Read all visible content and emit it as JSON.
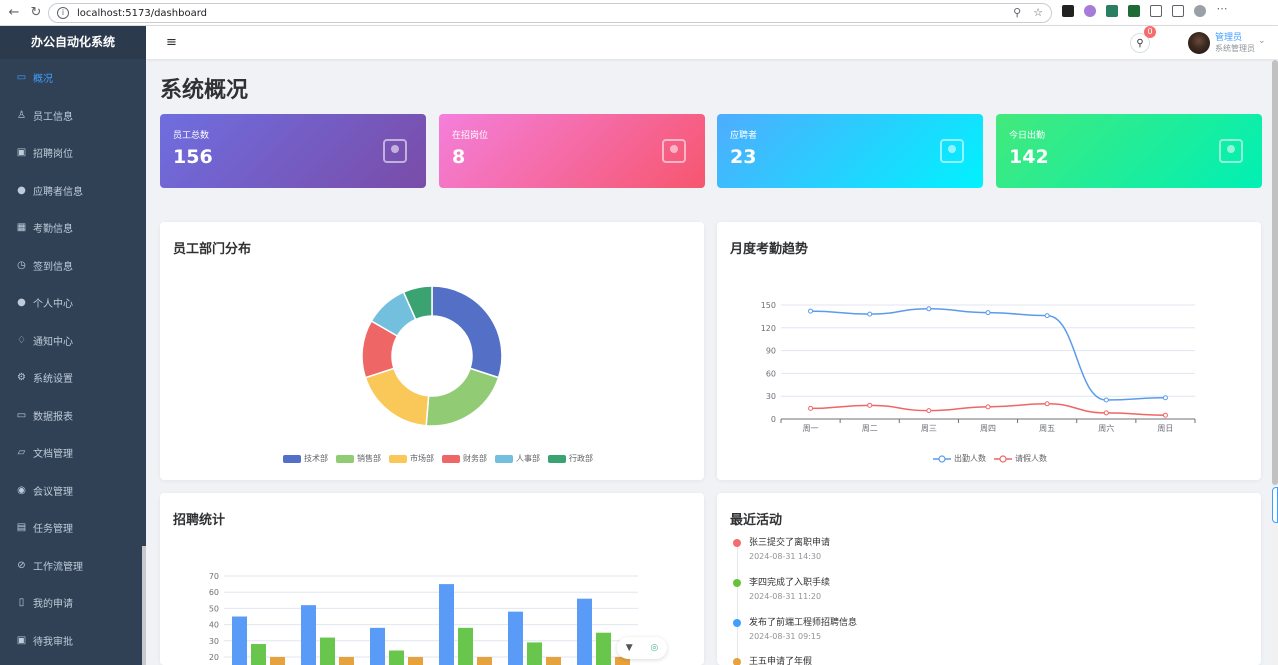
{
  "browser": {
    "url": "localhost:5173/dashboard"
  },
  "sidebar": {
    "logo": "办公自动化系统",
    "items": [
      {
        "label": "概况",
        "icon": "monitor-icon",
        "active": true
      },
      {
        "label": "员工信息",
        "icon": "user-icon"
      },
      {
        "label": "招聘岗位",
        "icon": "briefcase-icon"
      },
      {
        "label": "应聘者信息",
        "icon": "person-icon"
      },
      {
        "label": "考勤信息",
        "icon": "calendar-icon"
      },
      {
        "label": "签到信息",
        "icon": "clock-icon"
      },
      {
        "label": "个人中心",
        "icon": "user-filled-icon"
      },
      {
        "label": "通知中心",
        "icon": "bell-icon"
      },
      {
        "label": "系统设置",
        "icon": "gear-icon"
      },
      {
        "label": "数据报表",
        "icon": "report-icon"
      },
      {
        "label": "文档管理",
        "icon": "folder-icon"
      },
      {
        "label": "会议管理",
        "icon": "video-icon"
      },
      {
        "label": "任务管理",
        "icon": "task-icon"
      },
      {
        "label": "工作流管理",
        "icon": "link-icon"
      },
      {
        "label": "我的申请",
        "icon": "document-icon"
      },
      {
        "label": "待我审批",
        "icon": "approve-icon"
      }
    ]
  },
  "header": {
    "notifications": "0",
    "user_name": "管理员",
    "user_role": "系统管理员"
  },
  "page": {
    "title": "系统概况"
  },
  "stats": [
    {
      "label": "员工总数",
      "value": "156",
      "icon": "user-outline-icon",
      "from": "#6f6ee0",
      "to": "#7a4ca8"
    },
    {
      "label": "在招岗位",
      "value": "8",
      "icon": "briefcase-icon",
      "from": "#f47fdb",
      "to": "#f6566e"
    },
    {
      "label": "应聘者",
      "value": "23",
      "icon": "person-icon",
      "from": "#4facfe",
      "to": "#00f2fe"
    },
    {
      "label": "今日出勤",
      "value": "142",
      "icon": "calendar-icon",
      "from": "#43e97b",
      "to": "#00f0b5"
    }
  ],
  "panels": {
    "dept": "员工部门分布",
    "trend": "月度考勤趋势",
    "recruit": "招聘统计",
    "activity": "最近活动"
  },
  "chart_data": [
    {
      "type": "pie",
      "title": "员工部门分布",
      "categories": [
        "技术部",
        "销售部",
        "市场部",
        "财务部",
        "人事部",
        "行政部"
      ],
      "values": [
        45,
        32,
        28,
        20,
        15,
        10
      ],
      "colors": [
        "#5470c6",
        "#91cc75",
        "#fac858",
        "#ee6666",
        "#73c0de",
        "#3ba272"
      ],
      "legend": "bottom"
    },
    {
      "type": "line",
      "title": "月度考勤趋势",
      "categories": [
        "周一",
        "周二",
        "周三",
        "周四",
        "周五",
        "周六",
        "周日"
      ],
      "series": [
        {
          "name": "出勤人数",
          "values": [
            142,
            138,
            145,
            140,
            136,
            25,
            28
          ],
          "color": "#5b9bea"
        },
        {
          "name": "请假人数",
          "values": [
            14,
            18,
            11,
            16,
            20,
            8,
            5
          ],
          "color": "#ee6666"
        }
      ],
      "yticks": [
        0,
        30,
        60,
        90,
        120,
        150
      ],
      "ylim": [
        0,
        150
      ],
      "legend": "bottom"
    },
    {
      "type": "bar",
      "title": "招聘统计",
      "yticks": [
        20,
        30,
        40,
        50,
        60,
        70
      ],
      "ylim": [
        20,
        70
      ],
      "series": [
        {
          "values": [
            45,
            52,
            38,
            65,
            48,
            56
          ],
          "color": "#5b9bf8"
        },
        {
          "values": [
            28,
            32,
            24,
            38,
            29,
            35
          ],
          "color": "#67c64b"
        },
        {
          "values": [
            15,
            15,
            15,
            18,
            15,
            15
          ],
          "color": "#e6a23c"
        }
      ]
    }
  ],
  "activities": [
    {
      "text": "张三提交了离职申请",
      "time": "2024-08-31 14:30",
      "color": "#f56c6c"
    },
    {
      "text": "李四完成了入职手续",
      "time": "2024-08-31 11:20",
      "color": "#67c23a"
    },
    {
      "text": "发布了前端工程师招聘信息",
      "time": "2024-08-31 09:15",
      "color": "#409eff"
    },
    {
      "text": "王五申请了年假",
      "time": "",
      "color": "#e6a23c"
    }
  ]
}
